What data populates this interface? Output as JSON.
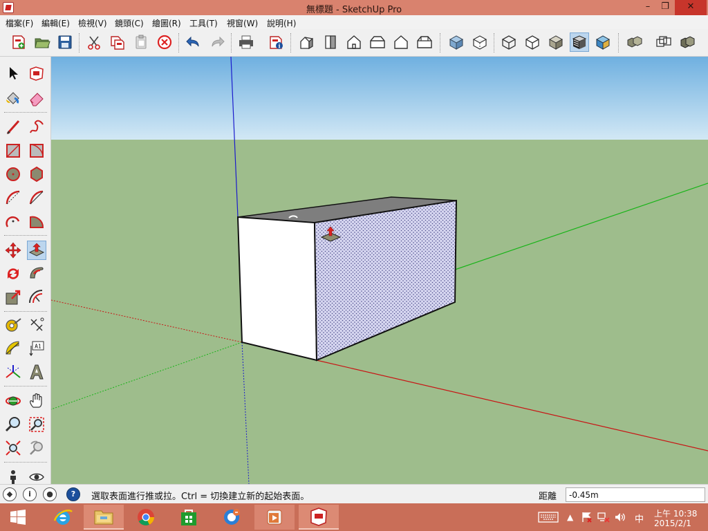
{
  "window": {
    "title": "無標題 - SketchUp Pro",
    "controls": {
      "minimize": "–",
      "maximize": "❐",
      "close": "✕"
    }
  },
  "menu": {
    "items": [
      "檔案(F)",
      "編輯(E)",
      "檢視(V)",
      "鏡頭(C)",
      "繪圖(R)",
      "工具(T)",
      "視窗(W)",
      "說明(H)"
    ]
  },
  "toolbar": {
    "icons": [
      "new-file-icon",
      "open-folder-icon",
      "save-icon",
      "cut-icon",
      "copy-icon",
      "paste-icon",
      "erase-selection-icon",
      "undo-icon",
      "redo-icon",
      "print-icon",
      "model-info-icon",
      "iso-view-icon",
      "top-view-icon",
      "front-view-icon",
      "right-view-icon",
      "back-view-icon",
      "left-view-icon",
      "xray-icon",
      "back-edges-icon",
      "wireframe-icon",
      "hidden-line-icon",
      "shaded-icon",
      "shaded-textures-icon",
      "monochrome-icon",
      "components-icon",
      "groups-icon",
      "solid-tools-icon"
    ]
  },
  "toolbox": {
    "tools": [
      "select-icon",
      "make-component-icon",
      "paint-bucket-icon",
      "eraser-icon",
      "line-icon",
      "freehand-icon",
      "rectangle-icon",
      "rotated-rectangle-icon",
      "circle-icon",
      "polygon-icon",
      "arc-icon",
      "two-point-arc-icon",
      "three-point-arc-icon",
      "pie-icon",
      "move-icon",
      "push-pull-icon",
      "rotate-icon",
      "follow-me-icon",
      "scale-icon",
      "offset-icon",
      "tape-measure-icon",
      "dimension-icon",
      "protractor-icon",
      "text-icon",
      "axes-icon",
      "3d-text-icon",
      "orbit-icon",
      "pan-icon",
      "zoom-icon",
      "zoom-window-icon",
      "zoom-extents-icon",
      "previous-view-icon",
      "position-camera-icon",
      "look-around-icon"
    ],
    "text_tool_label": "A1",
    "active_tool": "push-pull-icon"
  },
  "statusbar": {
    "hint": "選取表面進行推或拉。Ctrl = 切換建立新的起始表面。",
    "measure_label": "距離",
    "measure_value": "-0.45m",
    "help_glyph": "?",
    "info_glyph": "i"
  },
  "taskbar": {
    "apps": [
      "windows-start-icon",
      "internet-explorer-icon",
      "file-explorer-icon",
      "chrome-icon",
      "store-icon",
      "messenger-icon",
      "media-player-icon",
      "sketchup-icon"
    ],
    "tray": {
      "ime": "中",
      "time": "上午 10:38",
      "date": "2015/2/1"
    }
  },
  "colors": {
    "sky": "#9fcde8",
    "ground": "#9ebd8c",
    "axis_red": "#c81414",
    "axis_green": "#17b417",
    "axis_blue": "#1a1acc",
    "taskbar": "#c96e58",
    "titlebar": "#d9826e"
  }
}
